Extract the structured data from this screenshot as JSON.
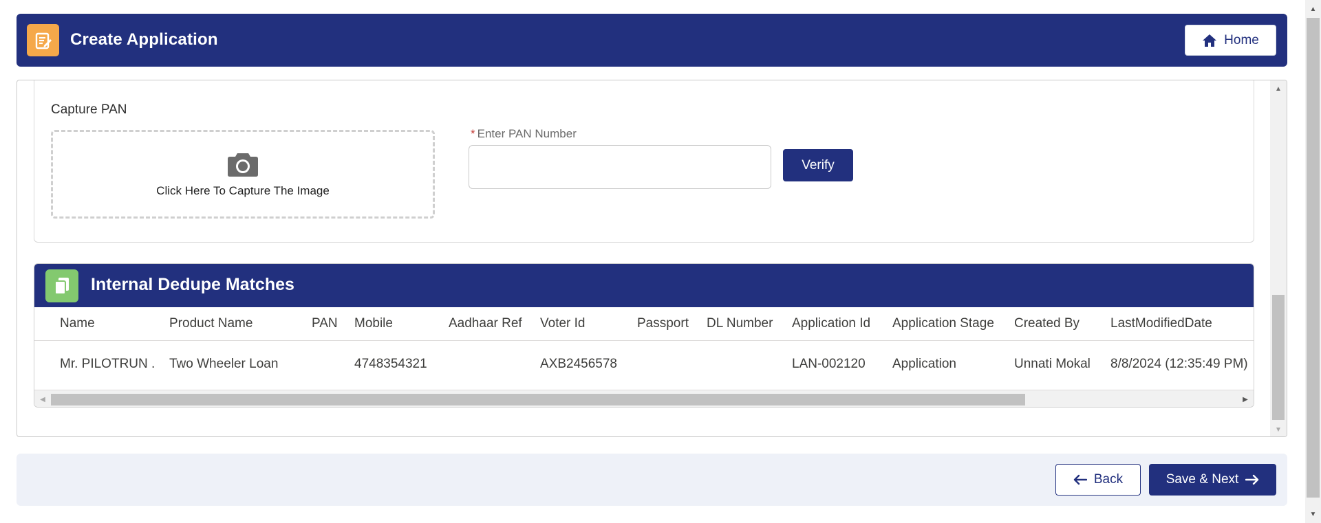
{
  "header": {
    "title": "Create Application",
    "home_label": "Home",
    "bg_color": "#22307e",
    "icon_color": "#f5a84a"
  },
  "pan_section": {
    "title": "Capture PAN",
    "capture_text": "Click Here To Capture The Image",
    "required_marker": "*",
    "pan_label": "Enter PAN Number",
    "pan_value": "",
    "verify_label": "Verify"
  },
  "dedupe": {
    "title": "Internal Dedupe Matches",
    "icon_color": "#83c96f",
    "columns": [
      "Name",
      "Product Name",
      "PAN",
      "Mobile",
      "Aadhaar Ref",
      "Voter Id",
      "Passport",
      "DL Number",
      "Application Id",
      "Application Stage",
      "Created By",
      "LastModifiedDate"
    ],
    "rows": [
      [
        "Mr. PILOTRUN .",
        "Two Wheeler Loan",
        "",
        "4748354321",
        "",
        "AXB2456578",
        "",
        "",
        "LAN-002120",
        "Application",
        "Unnati Mokal",
        "8/8/2024 (12:35:49 PM)"
      ]
    ]
  },
  "footer": {
    "back_label": "Back",
    "next_label": "Save & Next"
  }
}
